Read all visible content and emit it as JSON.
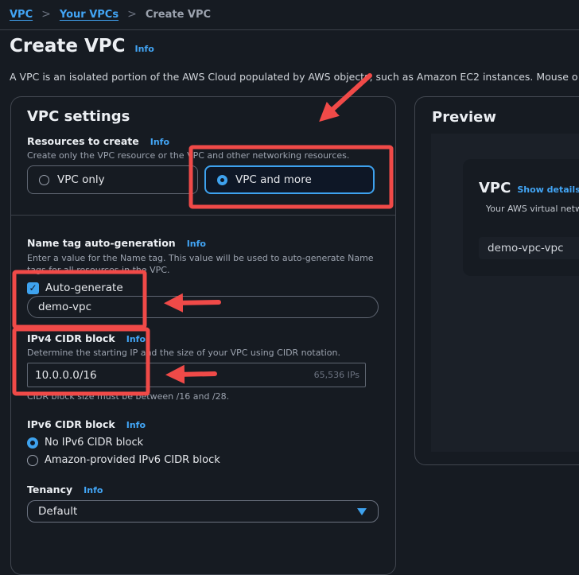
{
  "breadcrumb": {
    "items": [
      {
        "label": "VPC",
        "link": true
      },
      {
        "label": "Your VPCs",
        "link": true
      },
      {
        "label": "Create VPC",
        "link": false
      }
    ],
    "separator": ">"
  },
  "header": {
    "title": "Create VPC",
    "info": "Info",
    "description": "A VPC is an isolated portion of the AWS Cloud populated by AWS objects, such as Amazon EC2 instances. Mouse o"
  },
  "vpc_settings": {
    "title": "VPC settings",
    "resources": {
      "label": "Resources to create",
      "info": "Info",
      "hint": "Create only the VPC resource or the VPC and other networking resources.",
      "options": [
        {
          "label": "VPC only",
          "selected": false
        },
        {
          "label": "VPC and more",
          "selected": true
        }
      ]
    },
    "name_tag": {
      "label": "Name tag auto-generation",
      "info": "Info",
      "hint": "Enter a value for the Name tag. This value will be used to auto-generate Name tags for all resources in the VPC.",
      "checkbox_label": "Auto-generate",
      "checked": true,
      "value": "demo-vpc"
    },
    "ipv4": {
      "label": "IPv4 CIDR block",
      "info": "Info",
      "hint": "Determine the starting IP and the size of your VPC using CIDR notation.",
      "value": "10.0.0.0/16",
      "suffix": "65,536 IPs",
      "constraint": "CIDR block size must be between /16 and /28."
    },
    "ipv6": {
      "label": "IPv6 CIDR block",
      "info": "Info",
      "options": [
        {
          "label": "No IPv6 CIDR block",
          "selected": true
        },
        {
          "label": "Amazon-provided IPv6 CIDR block",
          "selected": false
        }
      ]
    },
    "tenancy": {
      "label": "Tenancy",
      "info": "Info",
      "value": "Default"
    }
  },
  "preview": {
    "title": "Preview",
    "vpc_card": {
      "title": "VPC",
      "link": "Show details",
      "subtitle": "Your AWS virtual netw",
      "name": "demo-vpc-vpc"
    }
  },
  "annotations": {
    "color": "#f04a48"
  }
}
